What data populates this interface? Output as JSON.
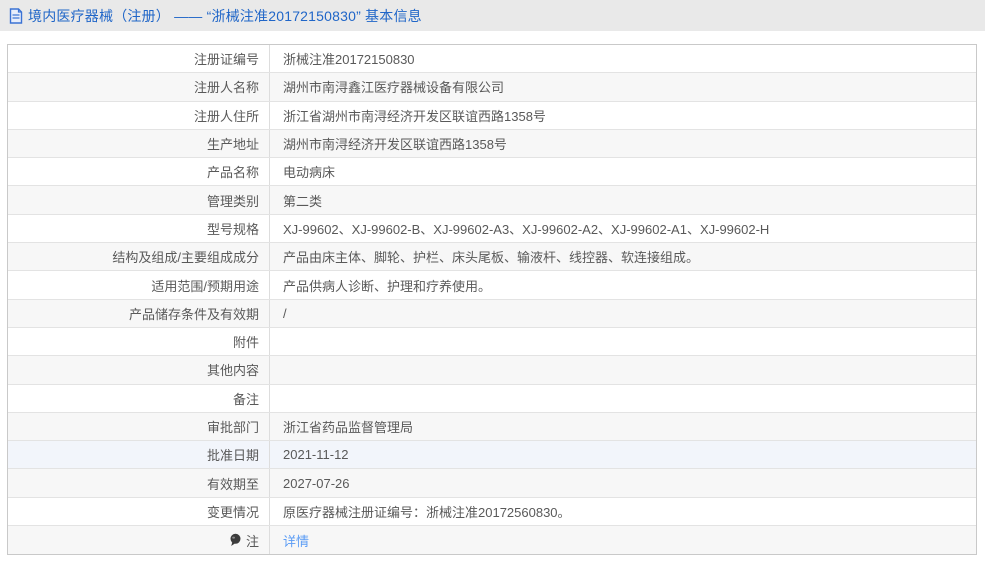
{
  "header": {
    "title": "境内医疗器械（注册） —— “浙械注准20172150830” 基本信息",
    "icon": "file-text-icon"
  },
  "colors": {
    "title_blue": "#2066c8",
    "link_blue": "#5b9cf5",
    "topbar_bg": "#e9e9e9",
    "row_alt_bg": "#f7f7f7",
    "row_highlight_bg": "#f2f5fb"
  },
  "table": {
    "rows": [
      {
        "label": "注册证编号",
        "value": "浙械注准20172150830"
      },
      {
        "label": "注册人名称",
        "value": "湖州市南浔鑫江医疗器械设备有限公司"
      },
      {
        "label": "注册人住所",
        "value": "浙江省湖州市南浔经济开发区联谊西路1358号"
      },
      {
        "label": "生产地址",
        "value": "湖州市南浔经济开发区联谊西路1358号"
      },
      {
        "label": "产品名称",
        "value": "电动病床"
      },
      {
        "label": "管理类别",
        "value": "第二类"
      },
      {
        "label": "型号规格",
        "value": "XJ-99602、XJ-99602-B、XJ-99602-A3、XJ-99602-A2、XJ-99602-A1、XJ-99602-H"
      },
      {
        "label": "结构及组成/主要组成成分",
        "value": "产品由床主体、脚轮、护栏、床头尾板、输液杆、线控器、软连接组成。"
      },
      {
        "label": "适用范围/预期用途",
        "value": "产品供病人诊断、护理和疗养使用。"
      },
      {
        "label": "产品储存条件及有效期",
        "value": "/"
      },
      {
        "label": "附件",
        "value": ""
      },
      {
        "label": "其他内容",
        "value": ""
      },
      {
        "label": "备注",
        "value": ""
      },
      {
        "label": "审批部门",
        "value": "浙江省药品监督管理局"
      },
      {
        "label": "批准日期",
        "value": "2021-11-12",
        "highlighted": true
      },
      {
        "label": "有效期至",
        "value": "2027-07-26"
      },
      {
        "label": "变更情况",
        "value": "原医疗器械注册证编号：浙械注准20172560830。"
      },
      {
        "label": "注",
        "value": "详情",
        "note_icon": true,
        "link": true
      }
    ]
  }
}
